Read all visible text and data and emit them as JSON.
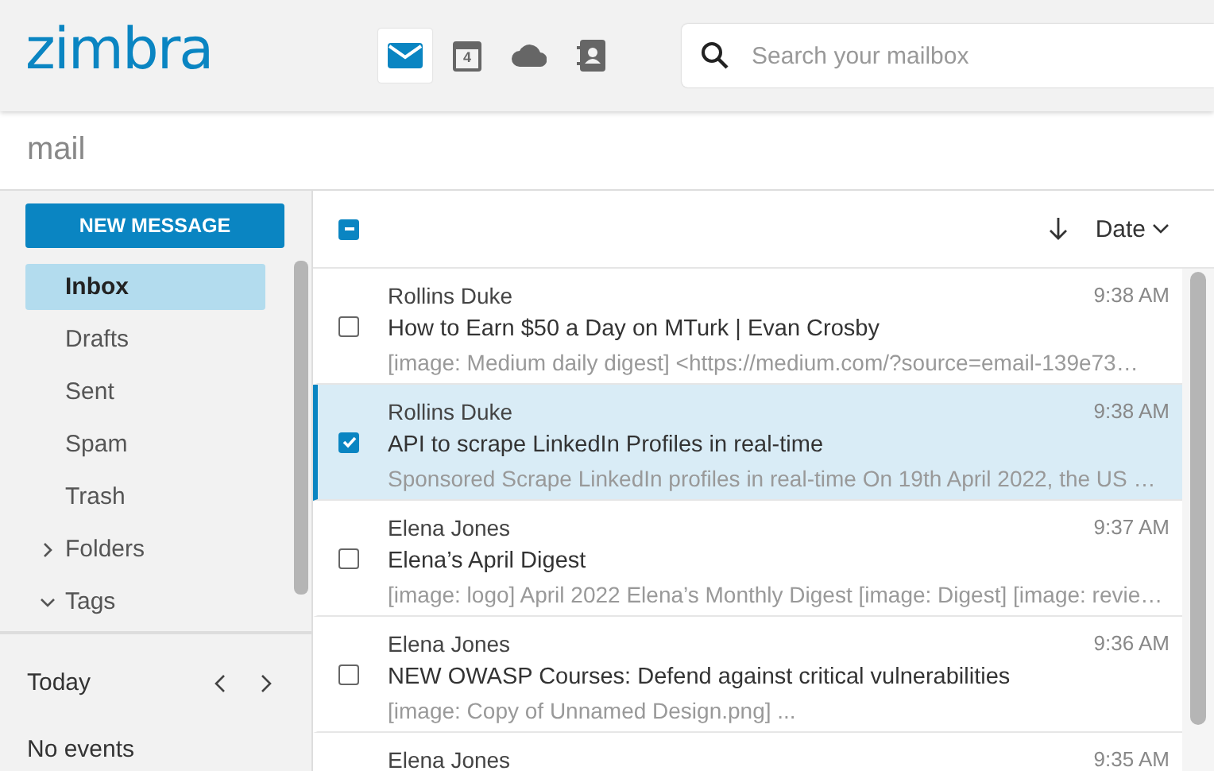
{
  "header": {
    "logo": "zimbra",
    "apps": [
      {
        "kind": "mail",
        "selected": true
      },
      {
        "kind": "calendar",
        "selected": false,
        "day": "4"
      },
      {
        "kind": "cloud",
        "selected": false
      },
      {
        "kind": "contacts",
        "selected": false
      }
    ],
    "search": {
      "placeholder": "Search your mailbox"
    }
  },
  "section_title": "mail",
  "sidebar": {
    "new_message": "NEW MESSAGE",
    "folders": [
      {
        "label": "Inbox",
        "kind": "folder",
        "selected": true
      },
      {
        "label": "Drafts",
        "kind": "folder",
        "selected": false
      },
      {
        "label": "Sent",
        "kind": "folder",
        "selected": false
      },
      {
        "label": "Spam",
        "kind": "folder",
        "selected": false
      },
      {
        "label": "Trash",
        "kind": "folder",
        "selected": false
      },
      {
        "label": "Folders",
        "kind": "group",
        "selected": false,
        "expanded": false
      },
      {
        "label": "Tags",
        "kind": "group",
        "selected": false,
        "expanded": true
      }
    ],
    "calendar": {
      "label": "Today",
      "empty": "No events"
    }
  },
  "list": {
    "select_all": {
      "checked": true,
      "partial": true
    },
    "sort": "Date",
    "messages": [
      {
        "sender": "Rollins Duke",
        "time": "9:38 AM",
        "subject": "How to Earn $50 a Day on MTurk | Evan Crosby",
        "preview": "[image: Medium daily digest] <https://medium.com/?source=email-139e73…",
        "selected": false
      },
      {
        "sender": "Rollins Duke",
        "time": "9:38 AM",
        "subject": "API to scrape LinkedIn Profiles in real-time",
        "preview": "Sponsored Scrape LinkedIn profiles in real-time On 19th April 2022, the US …",
        "selected": true
      },
      {
        "sender": "Elena Jones",
        "time": "9:37 AM",
        "subject": "Elena’s April Digest",
        "preview": "[image: logo] April 2022 Elena’s Monthly Digest [image: Digest] [image: revie…",
        "selected": false
      },
      {
        "sender": "Elena Jones",
        "time": "9:36 AM",
        "subject": "NEW OWASP Courses: Defend against critical vulnerabilities",
        "preview": "[image: Copy of Unnamed Design.png] ...",
        "selected": false
      },
      {
        "sender": "Elena Jones",
        "time": "9:35 AM",
        "selected": false
      }
    ]
  }
}
